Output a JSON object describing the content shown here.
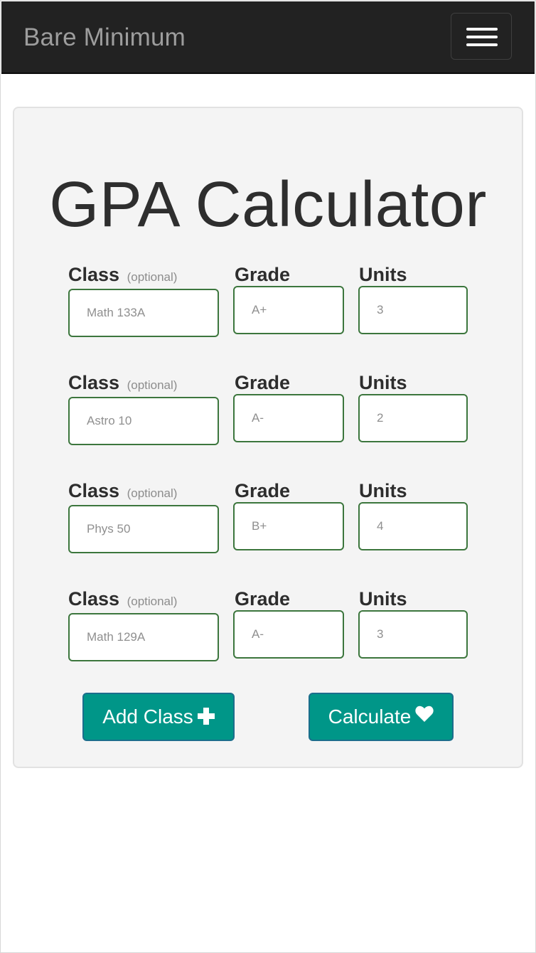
{
  "navbar": {
    "brand": "Bare Minimum",
    "toggle_icon": "hamburger-menu-icon",
    "background": "#222222",
    "brand_color": "#9d9d9d"
  },
  "calculator": {
    "title": "GPA Calculator",
    "labels": {
      "class": "Class",
      "optional": "(optional)",
      "grade": "Grade",
      "units": "Units"
    },
    "rows": [
      {
        "class_placeholder": "Math 133A",
        "grade_placeholder": "A+",
        "units_placeholder": "3"
      },
      {
        "class_placeholder": "Astro 10",
        "grade_placeholder": "A-",
        "units_placeholder": "2"
      },
      {
        "class_placeholder": "Phys 50",
        "grade_placeholder": "B+",
        "units_placeholder": "4"
      },
      {
        "class_placeholder": "Math 129A",
        "grade_placeholder": "A-",
        "units_placeholder": "3"
      }
    ],
    "buttons": {
      "add_label": "Add Class",
      "add_icon": "plus-icon",
      "calculate_label": "Calculate",
      "calculate_icon": "heart-icon"
    },
    "colors": {
      "input_border": "#3c763d",
      "button_bg": "#009688",
      "card_bg": "#f4f4f4"
    }
  }
}
